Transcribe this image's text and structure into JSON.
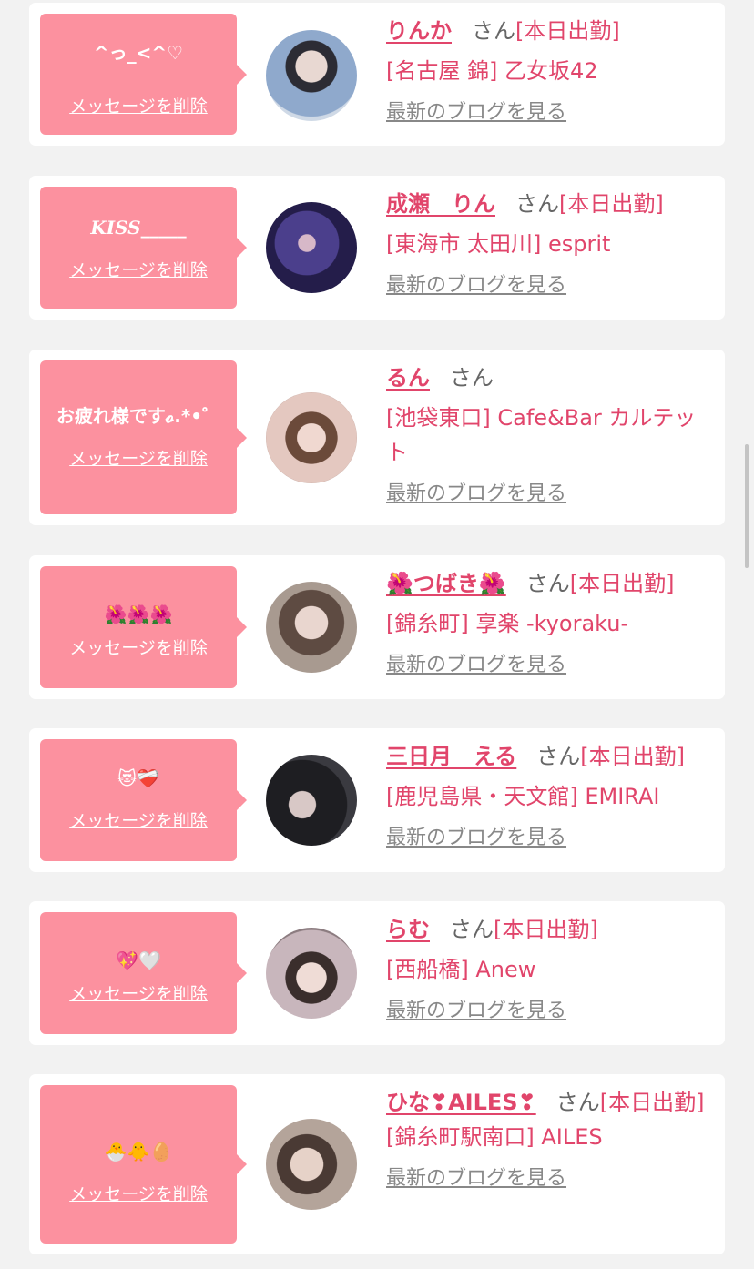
{
  "common": {
    "delete_label": "メッセージを削除",
    "blog_link": "最新のブログを見る",
    "san": "さん"
  },
  "entries": [
    {
      "message": "^っ_<^♡",
      "name": "りんか",
      "status": "[本日出勤]",
      "shop": "[名古屋 錦] 乙女坂42",
      "avatar_color": "#5a7fb0"
    },
    {
      "message": "KISS_____",
      "name": "成瀬　りん",
      "status": "[本日出勤]",
      "shop": "[東海市 太田川] esprit",
      "avatar_color": "#3a3270"
    },
    {
      "message": "お疲れ様です𝓸.*•゜",
      "name": "るん",
      "status": "",
      "shop": "[池袋東口] Cafe&Bar カルテット",
      "avatar_color": "#c9a59a"
    },
    {
      "message": "🌺🌺🌺",
      "name": "🌺つばき🌺",
      "status": "[本日出勤]",
      "shop": "[錦糸町] 享楽 -kyoraku-",
      "avatar_color": "#8f7d70"
    },
    {
      "message": "😻❤️‍🩹",
      "name": "三日月　える",
      "status": "[本日出勤]",
      "shop": "[鹿児島県・天文館] EMIRAI",
      "avatar_color": "#2a2a2e"
    },
    {
      "message": "💖🤍",
      "name": "らむ",
      "status": "[本日出勤]",
      "shop": "[西船橋] Anew",
      "avatar_color": "#b8a9b0"
    },
    {
      "message": "🐣🐥🥚",
      "name": "ひな❣AILES❣",
      "status": "[本日出勤]",
      "shop": "[錦糸町駅南口] AILES",
      "avatar_color": "#9b8a80"
    }
  ]
}
